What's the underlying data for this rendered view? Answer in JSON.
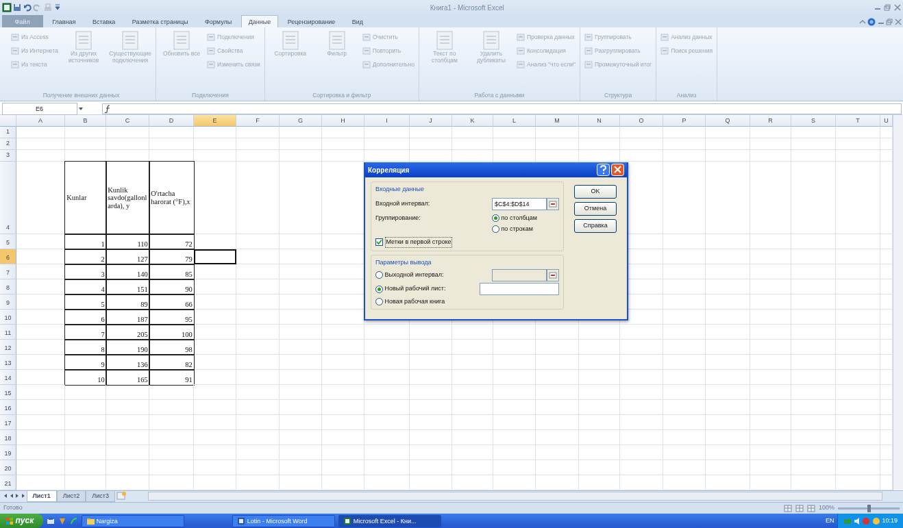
{
  "window": {
    "title": "Книга1 - Microsoft Excel"
  },
  "tabs": [
    {
      "label": "Файл",
      "kind": "file",
      "selected": false
    },
    {
      "label": "Главная",
      "kind": "tab",
      "selected": false
    },
    {
      "label": "Вставка",
      "kind": "tab",
      "selected": false
    },
    {
      "label": "Разметка страницы",
      "kind": "tab",
      "selected": false
    },
    {
      "label": "Формулы",
      "kind": "tab",
      "selected": false
    },
    {
      "label": "Данные",
      "kind": "tab",
      "selected": true
    },
    {
      "label": "Рецензирование",
      "kind": "tab",
      "selected": false
    },
    {
      "label": "Вид",
      "kind": "tab",
      "selected": false
    }
  ],
  "ribbon_groups": [
    {
      "label": "Получение внешних данных",
      "items": [
        {
          "label": "Из Access",
          "kind": "small"
        },
        {
          "label": "Из Интернета",
          "kind": "small"
        },
        {
          "label": "Из текста",
          "kind": "small"
        },
        {
          "label": "Из других источников",
          "kind": "large"
        },
        {
          "label": "Существующие подключения",
          "kind": "large"
        }
      ]
    },
    {
      "label": "Подключения",
      "items": [
        {
          "label": "Обновить все",
          "kind": "large"
        },
        {
          "label": "Подключения",
          "kind": "small"
        },
        {
          "label": "Свойства",
          "kind": "small"
        },
        {
          "label": "Изменить связи",
          "kind": "small"
        }
      ]
    },
    {
      "label": "Сортировка и фильтр",
      "items": [
        {
          "label": "Сортировка",
          "kind": "large"
        },
        {
          "label": "Фильтр",
          "kind": "large"
        },
        {
          "label": "Очистить",
          "kind": "small"
        },
        {
          "label": "Повторить",
          "kind": "small"
        },
        {
          "label": "Дополнительно",
          "kind": "small"
        }
      ]
    },
    {
      "label": "Работа с данными",
      "items": [
        {
          "label": "Текст по столбцам",
          "kind": "large"
        },
        {
          "label": "Удалить дубликаты",
          "kind": "large"
        },
        {
          "label": "Проверка данных",
          "kind": "small"
        },
        {
          "label": "Консолидация",
          "kind": "small"
        },
        {
          "label": "Анализ \"что если\"",
          "kind": "small"
        }
      ]
    },
    {
      "label": "Структура",
      "items": [
        {
          "label": "Группировать",
          "kind": "small"
        },
        {
          "label": "Разгруппировать",
          "kind": "small"
        },
        {
          "label": "Промежуточный итог",
          "kind": "small"
        }
      ]
    },
    {
      "label": "Анализ",
      "items": [
        {
          "label": "Анализ данных",
          "kind": "small"
        },
        {
          "label": "Поиск решения",
          "kind": "small"
        }
      ]
    }
  ],
  "formula_bar": {
    "name_box": "E6"
  },
  "sheet": {
    "columns": [
      {
        "label": "A",
        "selected": false
      },
      {
        "label": "B",
        "selected": false
      },
      {
        "label": "C",
        "selected": false
      },
      {
        "label": "D",
        "selected": false
      },
      {
        "label": "E",
        "selected": true
      },
      {
        "label": "F",
        "selected": false
      },
      {
        "label": "G",
        "selected": false
      },
      {
        "label": "H",
        "selected": false
      },
      {
        "label": "I",
        "selected": false
      },
      {
        "label": "J",
        "selected": false
      },
      {
        "label": "K",
        "selected": false
      },
      {
        "label": "L",
        "selected": false
      },
      {
        "label": "M",
        "selected": false
      },
      {
        "label": "N",
        "selected": false
      },
      {
        "label": "O",
        "selected": false
      },
      {
        "label": "P",
        "selected": false
      },
      {
        "label": "Q",
        "selected": false
      },
      {
        "label": "R",
        "selected": false
      },
      {
        "label": "S",
        "selected": false
      },
      {
        "label": "T",
        "selected": false
      },
      {
        "label": "U",
        "selected": false
      }
    ],
    "rows": [
      {
        "label": "1",
        "selected": false
      },
      {
        "label": "2",
        "selected": false
      },
      {
        "label": "3",
        "selected": false
      },
      {
        "label": "4",
        "selected": false
      },
      {
        "label": "5",
        "selected": false
      },
      {
        "label": "6",
        "selected": true
      },
      {
        "label": "7",
        "selected": false
      },
      {
        "label": "8",
        "selected": false
      },
      {
        "label": "9",
        "selected": false
      },
      {
        "label": "10",
        "selected": false
      },
      {
        "label": "11",
        "selected": false
      },
      {
        "label": "12",
        "selected": false
      },
      {
        "label": "13",
        "selected": false
      },
      {
        "label": "14",
        "selected": false
      },
      {
        "label": "15",
        "selected": false
      },
      {
        "label": "16",
        "selected": false
      },
      {
        "label": "17",
        "selected": false
      },
      {
        "label": "18",
        "selected": false
      },
      {
        "label": "19",
        "selected": false
      },
      {
        "label": "20",
        "selected": false
      },
      {
        "label": "21",
        "selected": false
      }
    ]
  },
  "table": {
    "columns": [
      "Kunlar",
      "Kunlik savdo(gallonlarda), y",
      "O'rtacha harorat (°F),x"
    ],
    "rows": [
      [
        "1",
        "110",
        "72"
      ],
      [
        "2",
        "127",
        "79"
      ],
      [
        "3",
        "140",
        "85"
      ],
      [
        "4",
        "151",
        "90"
      ],
      [
        "5",
        "89",
        "66"
      ],
      [
        "6",
        "187",
        "95"
      ],
      [
        "7",
        "205",
        "100"
      ],
      [
        "8",
        "190",
        "98"
      ],
      [
        "9",
        "136",
        "82"
      ],
      [
        "10",
        "165",
        "91"
      ]
    ]
  },
  "dialog": {
    "title": "Корреляция",
    "input_group": "Входные данные",
    "input_range_label": "Входной интервал:",
    "input_range": "$C$4:$D$14",
    "grouping_label": "Группирование:",
    "grouping": [
      {
        "label": "по столбцам",
        "selected": true
      },
      {
        "label": "по строкам",
        "selected": false
      }
    ],
    "labels_in_first_row": {
      "label": "Метки в первой строке",
      "checked": true
    },
    "output_group": "Параметры вывода",
    "output": [
      {
        "label": "Выходной интервал:",
        "selected": false,
        "kind": "range"
      },
      {
        "label": "Новый рабочий лист:",
        "selected": true,
        "kind": "sheet"
      },
      {
        "label": "Новая рабочая книга",
        "selected": false,
        "kind": "none"
      }
    ],
    "buttons": [
      "OK",
      "Отмена",
      "Справка"
    ]
  },
  "sheet_tabs": [
    {
      "label": "Лист1",
      "selected": true
    },
    {
      "label": "Лист2",
      "selected": false
    },
    {
      "label": "Лист3",
      "selected": false
    }
  ],
  "status_bar": {
    "text": "Готово",
    "zoom": "100%",
    "zoom_slider": {
      "level": 0.5
    }
  },
  "taskbar": {
    "start": "пуск",
    "items": [
      {
        "label": "Nargiza",
        "kind": "folder",
        "selected": false
      },
      {
        "label": "Lotin - Microsoft Word",
        "kind": "word",
        "selected": false
      },
      {
        "label": "Microsoft Excel - Кни...",
        "kind": "excel",
        "selected": true
      }
    ],
    "language": "EN",
    "clock": "10:19"
  }
}
